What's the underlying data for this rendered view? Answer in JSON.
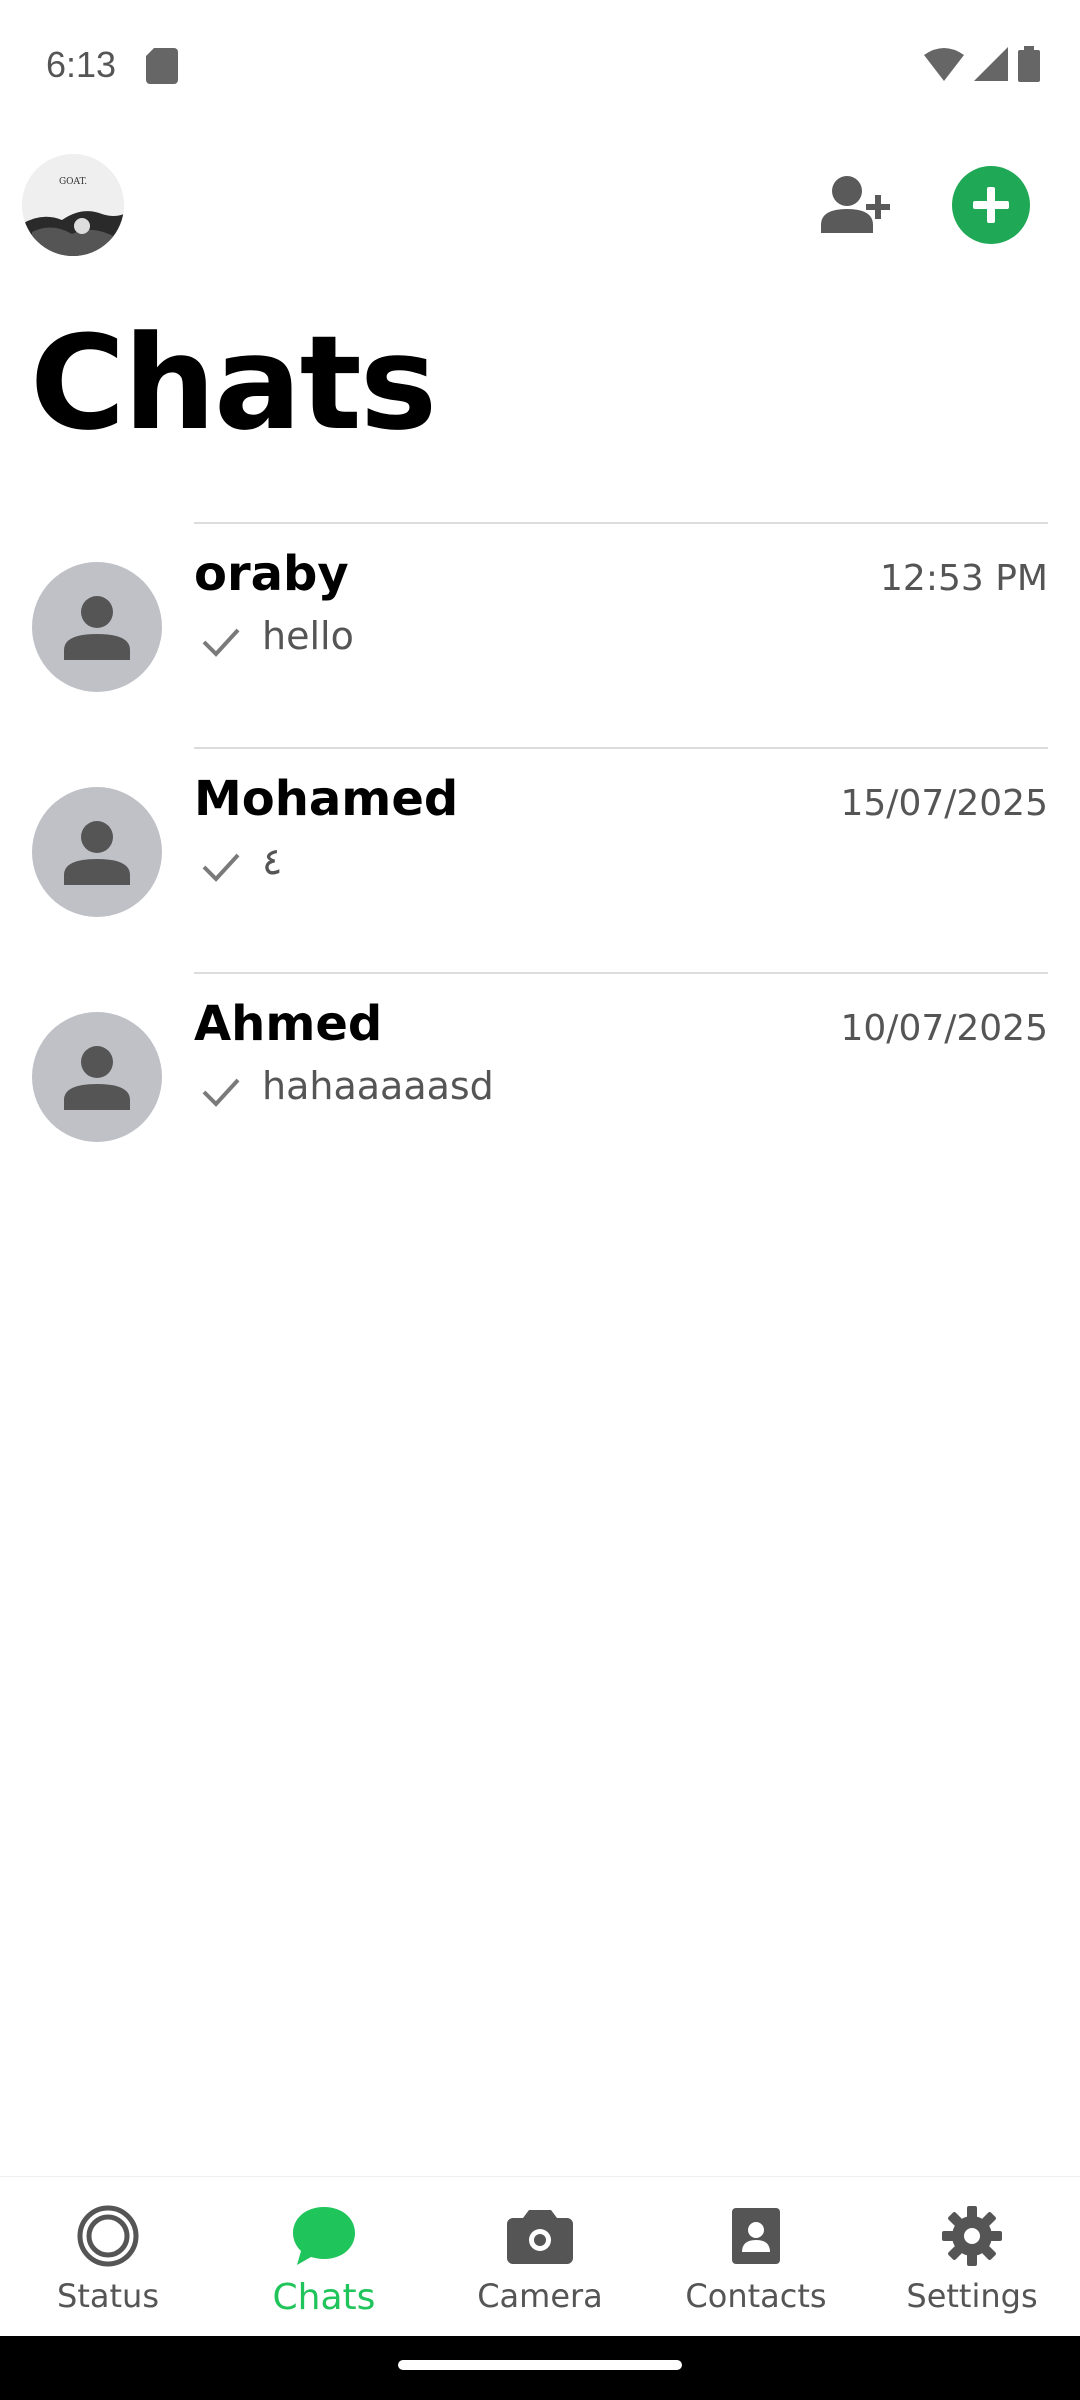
{
  "status_bar": {
    "time": "6:13"
  },
  "header": {
    "title": "Chats",
    "avatar_text": "GOAT."
  },
  "chats": [
    {
      "name": "oraby",
      "time": "12:53 PM",
      "preview": "hello"
    },
    {
      "name": "Mohamed",
      "time": "15/07/2025",
      "preview": "٤"
    },
    {
      "name": "Ahmed",
      "time": "10/07/2025",
      "preview": "hahaaaaasd"
    }
  ],
  "bottom_nav": {
    "items": [
      {
        "label": "Status",
        "icon": "status-icon"
      },
      {
        "label": "Chats",
        "icon": "chat-bubble-icon"
      },
      {
        "label": "Camera",
        "icon": "camera-icon"
      },
      {
        "label": "Contacts",
        "icon": "contacts-icon"
      },
      {
        "label": "Settings",
        "icon": "gear-icon"
      }
    ],
    "active_index": 1
  },
  "colors": {
    "accent": "#1fc45b",
    "fab": "#1fa855",
    "avatar_bg": "#bfc1c7",
    "text_secondary": "#555555"
  }
}
